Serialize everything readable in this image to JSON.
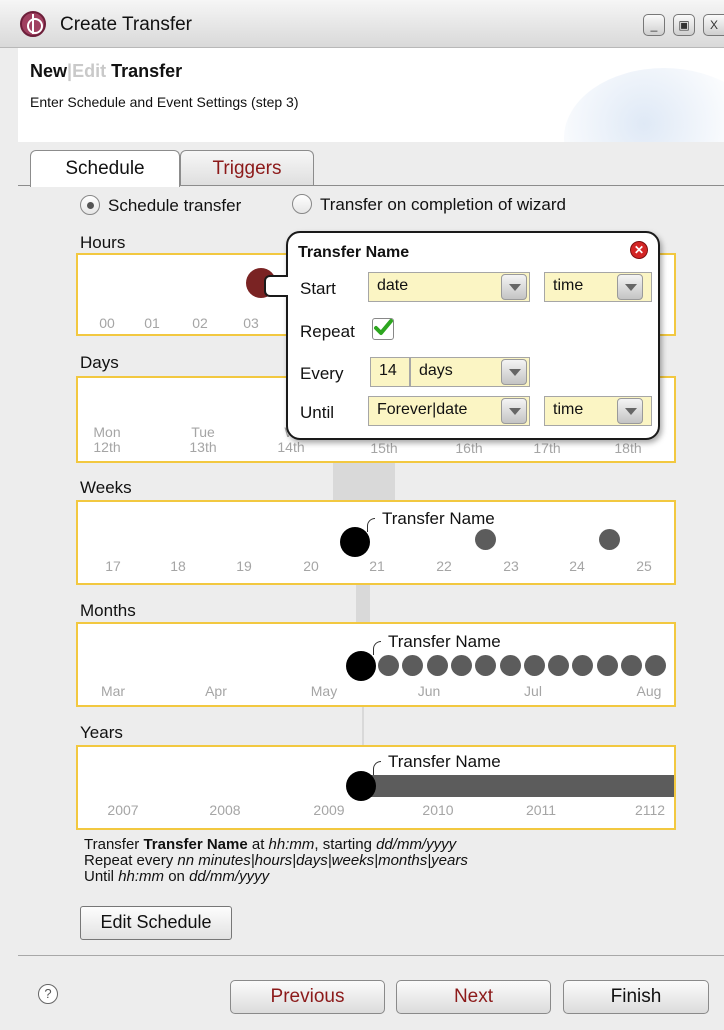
{
  "window": {
    "title": "Create Transfer",
    "buttons": [
      "_",
      "▣",
      "X"
    ]
  },
  "header": {
    "heading_new": "New",
    "heading_sep": "|",
    "heading_edit": "Edit",
    "heading_transfer": "Transfer",
    "subtitle": "Enter Schedule and Event Settings (step 3)"
  },
  "tabs": [
    {
      "label": "Schedule",
      "active": true
    },
    {
      "label": "Triggers",
      "active": false
    }
  ],
  "options": {
    "schedule_label": "Schedule transfer",
    "schedule_selected": true,
    "completion_label": "Transfer on completion of wizard",
    "completion_selected": false
  },
  "timelines": {
    "hours": {
      "label": "Hours",
      "ticks": [
        "00",
        "01",
        "02",
        "03"
      ]
    },
    "days": {
      "label": "Days",
      "ticks": [
        "Mon\n12th",
        "Tue\n13th",
        "W\n14th",
        "15th",
        "16th",
        "17th",
        "18th"
      ]
    },
    "weeks": {
      "label": "Weeks",
      "ticks": [
        "17",
        "18",
        "19",
        "20",
        "21",
        "22",
        "23",
        "24",
        "25"
      ],
      "marker": "Transfer Name"
    },
    "months": {
      "label": "Months",
      "ticks": [
        "Mar",
        "Apr",
        "May",
        "Jun",
        "Jul",
        "Aug"
      ],
      "marker": "Transfer Name"
    },
    "years": {
      "label": "Years",
      "ticks": [
        "2007",
        "2008",
        "2009",
        "2010",
        "2011",
        "2112"
      ],
      "marker": "Transfer Name"
    }
  },
  "popup": {
    "title": "Transfer Name",
    "start_label": "Start",
    "start_date": "date",
    "start_time": "time",
    "repeat_label": "Repeat",
    "repeat_checked": true,
    "every_label": "Every",
    "every_value": "14",
    "every_unit": "days",
    "until_label": "Until",
    "until_value": "Forever|date",
    "until_time": "time"
  },
  "summary": {
    "line1_a": "Transfer ",
    "line1_name": "Transfer Name",
    "line1_b": " at ",
    "line1_time": "hh:mm",
    "line1_c": ", starting ",
    "line1_date": "dd/mm/yyyy",
    "line2_a": "Repeat every ",
    "line2_units": "nn minutes|hours|days|weeks|months|years",
    "line3_a": "Until ",
    "line3_time": "hh:mm",
    "line3_b": " on ",
    "line3_date": "dd/mm/yyyy"
  },
  "edit_schedule_label": "Edit Schedule",
  "footer": {
    "help": "?",
    "previous": "Previous",
    "next": "Next",
    "finish": "Finish"
  },
  "colors": {
    "accent_dark_red": "#8c1a1a",
    "timeline_border": "#f2c840",
    "field_fill": "#fbf5c4",
    "hour_marker": "#7a2323"
  }
}
